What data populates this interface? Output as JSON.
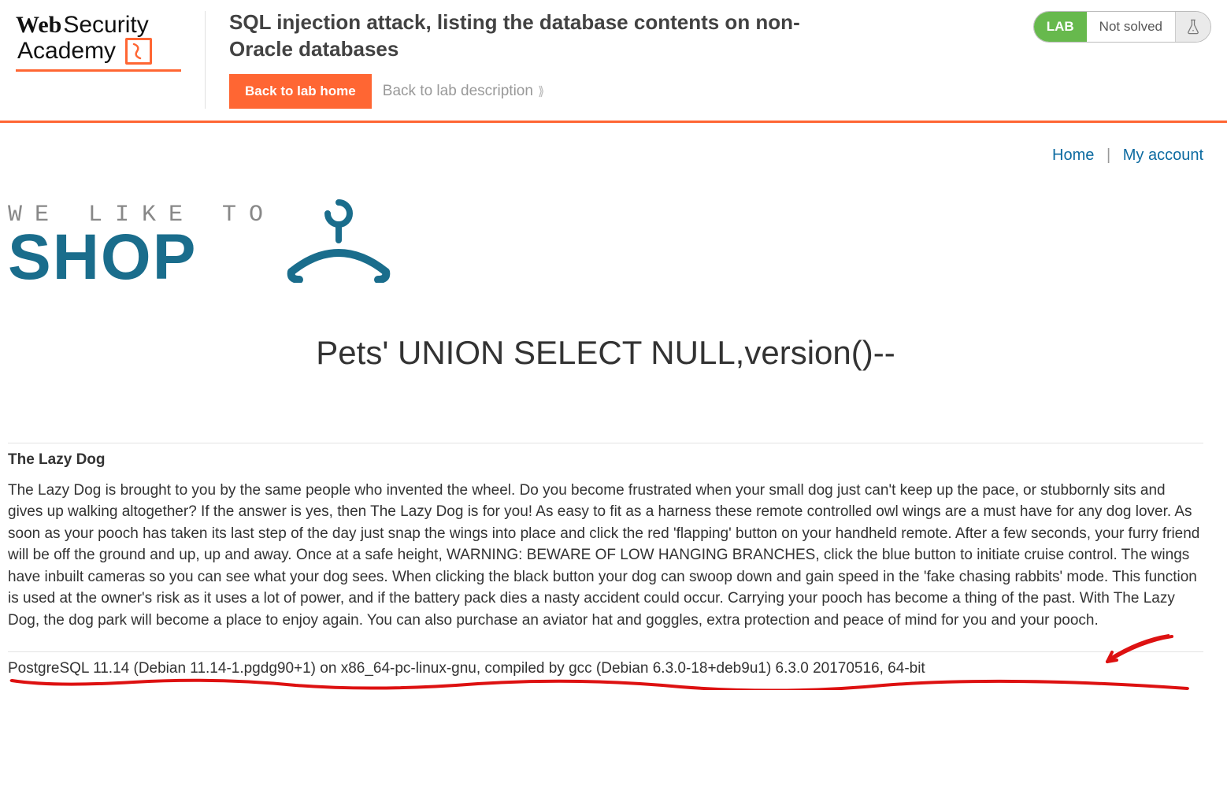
{
  "logo": {
    "line1a": "Web",
    "line1b": "Security",
    "line2": "Academy"
  },
  "lab_title": "SQL injection attack, listing the database contents on non-Oracle databases",
  "buttons": {
    "back_home": "Back to lab home",
    "back_desc": "Back to lab description"
  },
  "badge": {
    "lab": "LAB",
    "status": "Not solved"
  },
  "nav": {
    "home": "Home",
    "account": "My account"
  },
  "banner": {
    "pretitle": "WE LIKE TO",
    "title": "SHOP"
  },
  "page_heading": "Pets' UNION SELECT NULL,version()--",
  "items": [
    {
      "title": "The Lazy Dog",
      "body": "The Lazy Dog is brought to you by the same people who invented the wheel. Do you become frustrated when your small dog just can't keep up the pace, or stubbornly sits and gives up walking altogether? If the answer is yes, then The Lazy Dog is for you! As easy to fit as a harness these remote controlled owl wings are a must have for any dog lover. As soon as your pooch has taken its last step of the day just snap the wings into place and click the red 'flapping' button on your handheld remote. After a few seconds, your furry friend will be off the ground and up, up and away. Once at a safe height, WARNING: BEWARE OF LOW HANGING BRANCHES, click the blue button to initiate cruise control. The wings have inbuilt cameras so you can see what your dog sees. When clicking the black button your dog can swoop down and gain speed in the 'fake chasing rabbits' mode. This function is used at the owner's risk as it uses a lot of power, and if the battery pack dies a nasty accident could occur. Carrying your pooch has become a thing of the past. With The Lazy Dog, the dog park will become a place to enjoy again. You can also purchase an aviator hat and goggles, extra protection and peace of mind for you and your pooch."
    }
  ],
  "db_version": "PostgreSQL 11.14 (Debian 11.14-1.pgdg90+1) on x86_64-pc-linux-gnu, compiled by gcc (Debian 6.3.0-18+deb9u1) 6.3.0 20170516, 64-bit"
}
